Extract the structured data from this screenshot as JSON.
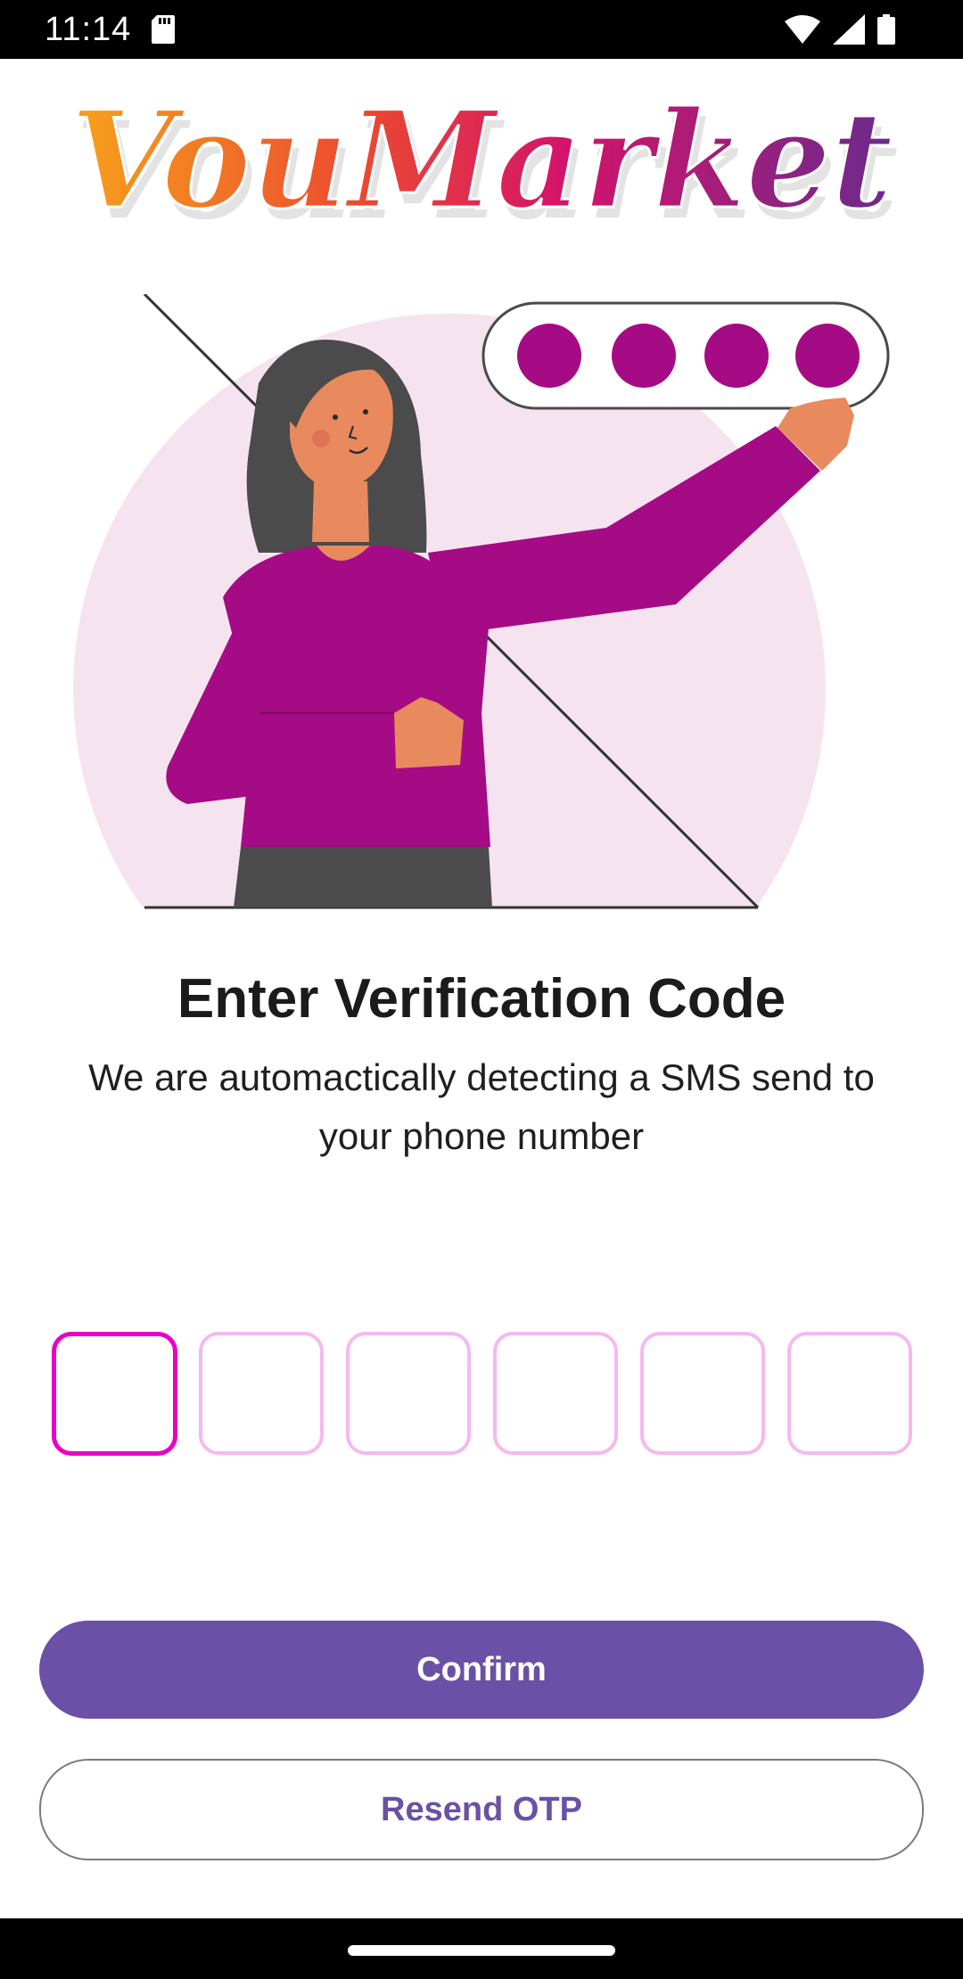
{
  "status_bar": {
    "time": "11:14",
    "icons": [
      "sd-card-icon",
      "wifi-icon",
      "cell-signal-icon",
      "battery-icon"
    ]
  },
  "logo": {
    "text": "VouMarket",
    "gradient_colors": [
      "#f7a21b",
      "#e8205a",
      "#c2168a",
      "#6b2a8c"
    ]
  },
  "illustration": {
    "pin_dots": 4,
    "accent_color": "#a50b85",
    "circle_color": "#f5e4f0"
  },
  "verification": {
    "title": "Enter Verification Code",
    "subtitle": "We are automactically detecting a SMS send to your phone number"
  },
  "otp": {
    "digit_count": 6,
    "values": [
      "",
      "",
      "",
      "",
      "",
      ""
    ],
    "active_index": 0,
    "active_border_color": "#e800c8",
    "inactive_border_color": "#f6b8ef"
  },
  "actions": {
    "confirm_label": "Confirm",
    "resend_label": "Resend OTP",
    "primary_color": "#6a50a6"
  }
}
